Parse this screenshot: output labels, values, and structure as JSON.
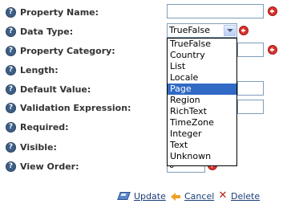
{
  "form": {
    "fields": [
      {
        "label": "Property Name:"
      },
      {
        "label": "Data Type:"
      },
      {
        "label": "Property Category:"
      },
      {
        "label": "Length:"
      },
      {
        "label": "Default Value:"
      },
      {
        "label": "Validation Expression:"
      },
      {
        "label": "Required:"
      },
      {
        "label": "Visible:"
      },
      {
        "label": "View Order:"
      }
    ],
    "property_name_value": "",
    "data_type_selected": "TrueFalse",
    "view_order_value": "0",
    "help_icon_glyph": "?"
  },
  "dropdown": {
    "options": [
      "TrueFalse",
      "Country",
      "List",
      "Locale",
      "Page",
      "Region",
      "RichText",
      "TimeZone",
      "Integer",
      "Text",
      "Unknown"
    ],
    "highlighted": "Page"
  },
  "actions": {
    "update": "Update",
    "cancel": "Cancel",
    "delete": "Delete"
  },
  "colors": {
    "highlight": "#316ac5",
    "link": "#1a3d7a",
    "required_icon": "#d9332b",
    "help_icon": "#3e5f86"
  },
  "icons": {
    "help": "help-icon",
    "required": "required-icon",
    "update": "update-icon",
    "cancel": "cancel-icon",
    "delete": "delete-icon"
  }
}
